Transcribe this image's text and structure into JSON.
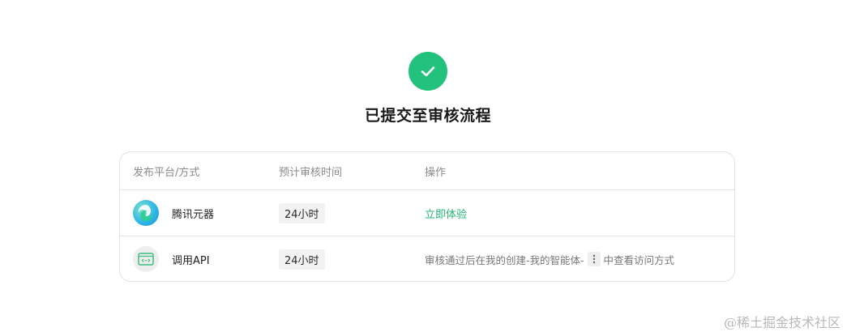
{
  "result": {
    "title": "已提交至审核流程",
    "status_color": "#22c27c"
  },
  "table": {
    "headers": {
      "platform": "发布平台/方式",
      "review_time": "预计审核时间",
      "action": "操作"
    },
    "rows": [
      {
        "platform": "腾讯元器",
        "logo_icon": "tencent-yuanqi-logo",
        "review_time": "24小时",
        "action_link": "立即体验"
      },
      {
        "platform": "调用API",
        "logo_icon": "api-icon",
        "review_time": "24小时",
        "action_prefix": "审核通过后在我的创建-我的智能体-",
        "action_icon": "more-vertical-icon",
        "action_suffix": "中查看访问方式"
      }
    ]
  },
  "colors": {
    "accent": "#22b573"
  },
  "watermark": "@稀土掘金技术社区"
}
